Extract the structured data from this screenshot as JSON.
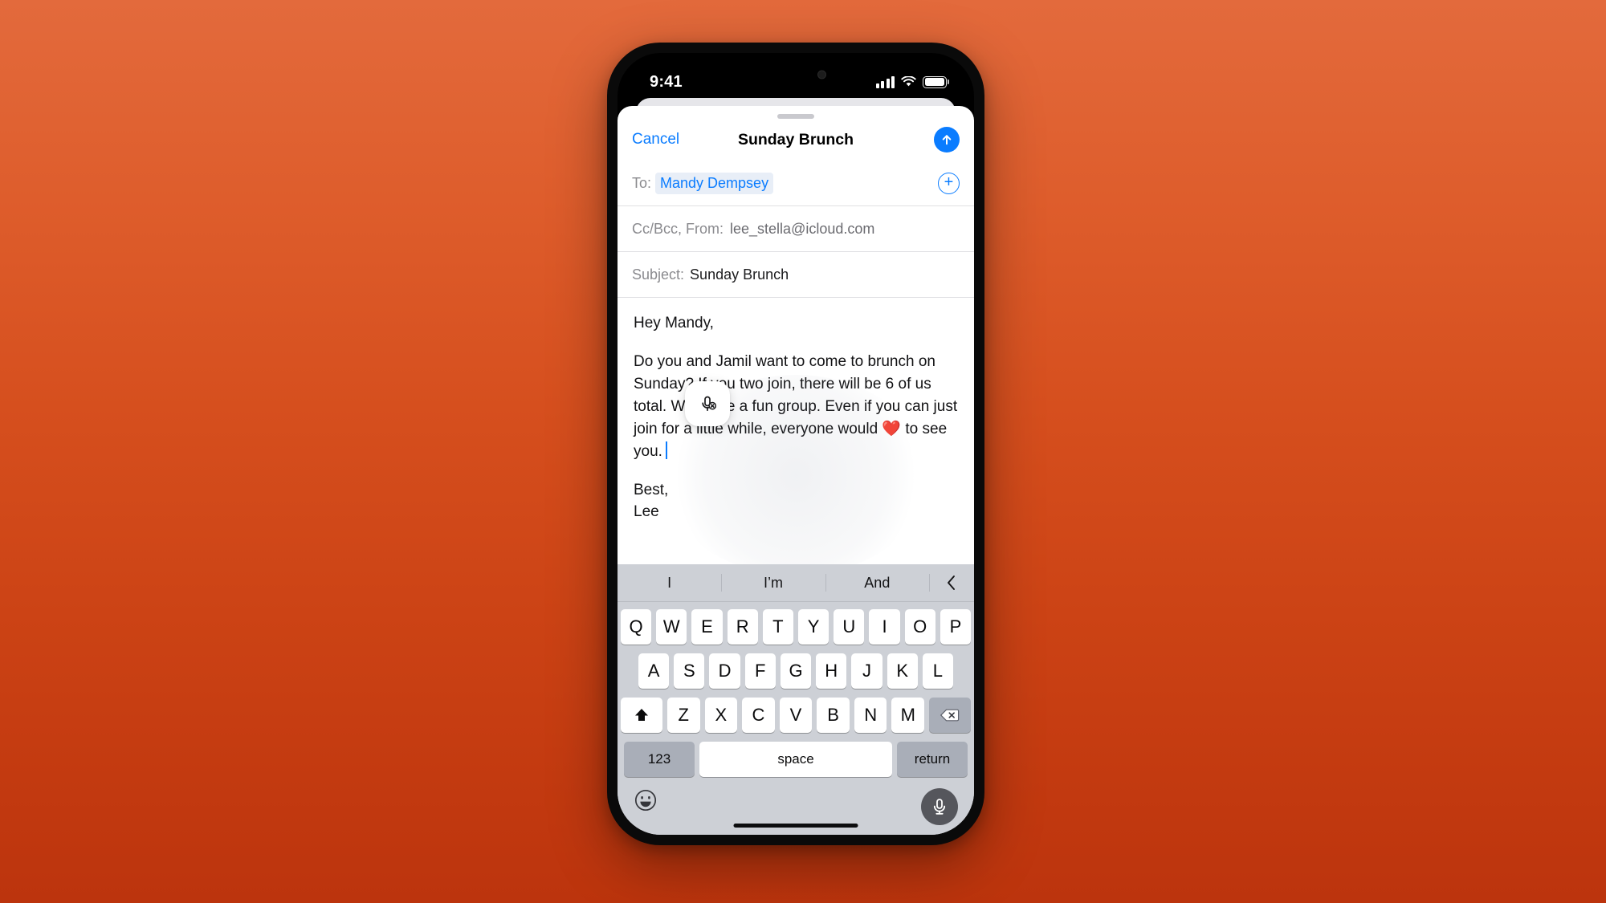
{
  "status_bar": {
    "time": "9:41",
    "cellular_icon": "cellular-signal-icon",
    "wifi_icon": "wifi-icon",
    "battery_icon": "battery-icon"
  },
  "nav": {
    "cancel_label": "Cancel",
    "title": "Sunday Brunch",
    "send_icon": "arrow-up-icon",
    "accent_color": "#0a7cff"
  },
  "fields": {
    "to_label": "To:",
    "to_recipient": "Mandy Dempsey",
    "add_contact_icon": "plus-circle-icon",
    "ccbcc_from_label": "Cc/Bcc, From:",
    "from_value": "lee_stella@icloud.com",
    "subject_label": "Subject:",
    "subject_value": "Sunday Brunch"
  },
  "body": {
    "greeting": "Hey Mandy,",
    "paragraph": "Do you and Jamil want to come to brunch on Sunday? If you two join, there will be 6 of us total. Would be a fun group. Even if you can just join for a little while, everyone would ❤️ to see you.",
    "signoff": "Best,",
    "signature": "Lee",
    "dictation_icon": "microphone-off-icon"
  },
  "keyboard": {
    "predictions": [
      "I",
      "I’m",
      "And"
    ],
    "collapse_icon": "chevron-left-icon",
    "row1": [
      "Q",
      "W",
      "E",
      "R",
      "T",
      "Y",
      "U",
      "I",
      "O",
      "P"
    ],
    "row2": [
      "A",
      "S",
      "D",
      "F",
      "G",
      "H",
      "J",
      "K",
      "L"
    ],
    "row3": [
      "Z",
      "X",
      "C",
      "V",
      "B",
      "N",
      "M"
    ],
    "shift_icon": "shift-arrow-icon",
    "delete_icon": "backspace-delete-icon",
    "numbers_label": "123",
    "space_label": "space",
    "return_label": "return",
    "emoji_icon": "emoji-smiley-icon",
    "mic_icon": "microphone-icon"
  },
  "theme": {
    "background_top": "#E36A3C",
    "background_bottom": "#BC340D",
    "keyboard_background": "#cdd0d6",
    "key_background": "#ffffff",
    "key_dark_background": "#a9aeb8"
  }
}
